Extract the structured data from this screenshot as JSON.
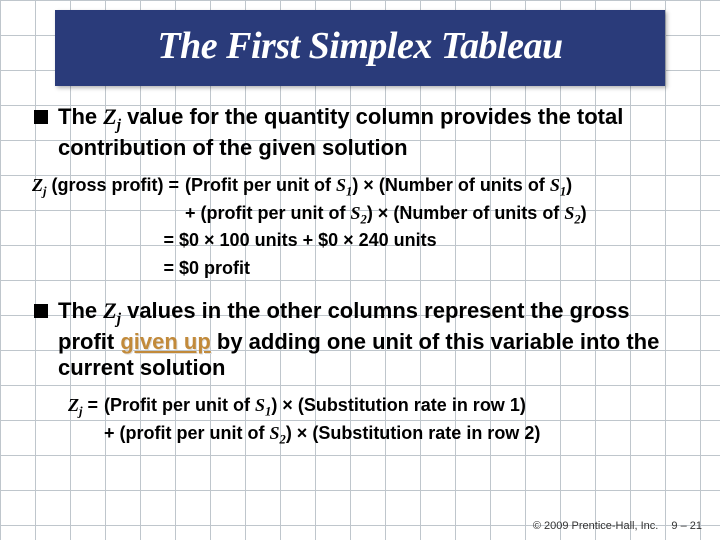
{
  "title": "The First Simplex Tableau",
  "bullet1": {
    "pre": "The ",
    "zj": "Z",
    "zjsub": "j",
    "post": " value for the quantity column provides the total contribution of the given solution"
  },
  "eq1": {
    "lhs_z": "Z",
    "lhs_sub": "j",
    "lhs_tail": " (gross profit)  =",
    "r1a": "(Profit per unit of ",
    "r1s": "S",
    "r1sub": "1",
    "r1b": ") × (Number of units of ",
    "r1s2": "S",
    "r1sub2": "1",
    "r1c": ")",
    "r2a": "+ (profit per unit of ",
    "r2s": "S",
    "r2sub": "2",
    "r2b": ") × (Number of units of ",
    "r2s2": "S",
    "r2sub2": "2",
    "r2c": ")",
    "r3": "=  $0 × 100 units + $0 × 240 units",
    "r4": "=  $0 profit"
  },
  "bullet2": {
    "pre": "The ",
    "zj": "Z",
    "zjsub": "j",
    "mid1": " values in the other columns represent the gross profit ",
    "givenup": "given up",
    "mid2": " by adding one unit of this variable into the current solution"
  },
  "eq2": {
    "lhs_z": "Z",
    "lhs_sub": "j",
    "lhs_tail": "  =",
    "r1a": "(Profit per unit of ",
    "r1s": "S",
    "r1sub": "1",
    "r1b": ") × (Substitution rate in row 1)",
    "r2a": "+ (profit per unit of ",
    "r2s": "S",
    "r2sub": "2",
    "r2b": ") × (Substitution rate in row 2)"
  },
  "footer": {
    "copyright": "© 2009 Prentice-Hall, Inc.",
    "page": "9 – 21"
  }
}
